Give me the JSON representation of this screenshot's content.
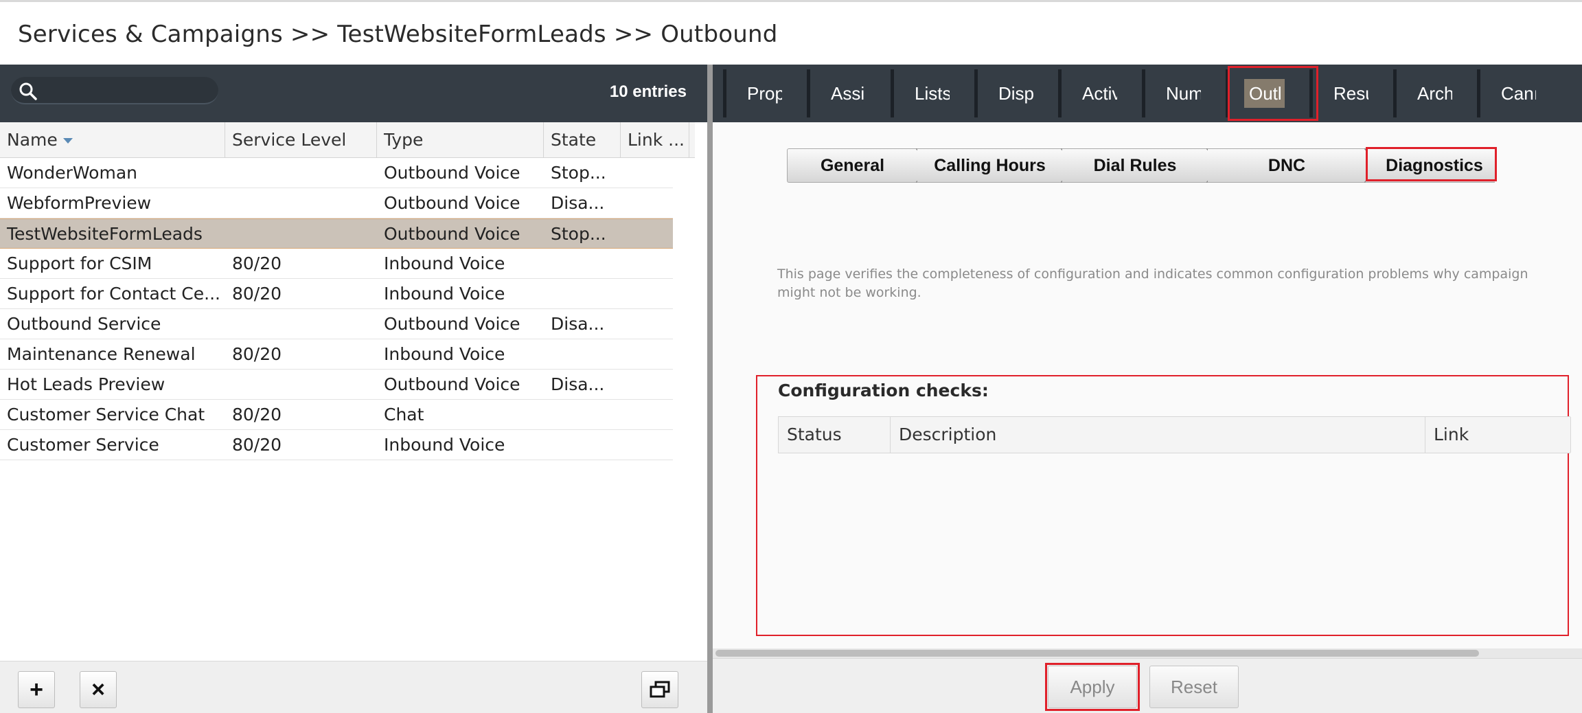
{
  "header": {
    "breadcrumb": "Services & Campaigns >> TestWebsiteFormLeads >> Outbound"
  },
  "left_panel": {
    "search": {
      "placeholder": "",
      "icon": "search-icon"
    },
    "entries_count": "10 entries",
    "columns": [
      "Name",
      "Service Level",
      "Type",
      "State",
      "Link ..."
    ],
    "sort_column": "Name",
    "rows": [
      {
        "name": "WonderWoman",
        "service_level": "",
        "type": "Outbound Voice",
        "state": "Stop...",
        "link": ""
      },
      {
        "name": "WebformPreview",
        "service_level": "",
        "type": "Outbound Voice",
        "state": "Disa...",
        "link": ""
      },
      {
        "name": "TestWebsiteFormLeads",
        "service_level": "",
        "type": "Outbound Voice",
        "state": "Stop...",
        "link": "",
        "selected": true
      },
      {
        "name": "Support for CSIM",
        "service_level": "80/20",
        "type": "Inbound Voice",
        "state": "",
        "link": ""
      },
      {
        "name": "Support for Contact Ce...",
        "service_level": "80/20",
        "type": "Inbound Voice",
        "state": "",
        "link": ""
      },
      {
        "name": "Outbound Service",
        "service_level": "",
        "type": "Outbound Voice",
        "state": "Disa...",
        "link": ""
      },
      {
        "name": "Maintenance Renewal",
        "service_level": "80/20",
        "type": "Inbound Voice",
        "state": "",
        "link": ""
      },
      {
        "name": "Hot Leads Preview",
        "service_level": "",
        "type": "Outbound Voice",
        "state": "Disa...",
        "link": ""
      },
      {
        "name": "Customer Service Chat",
        "service_level": "80/20",
        "type": "Chat",
        "state": "",
        "link": ""
      },
      {
        "name": "Customer Service",
        "service_level": "80/20",
        "type": "Inbound Voice",
        "state": "",
        "link": ""
      }
    ],
    "footer_buttons": {
      "add": "+",
      "delete": "×",
      "window_icon": "restore-window-icon"
    }
  },
  "right_panel": {
    "tabs": [
      "Prop",
      "Assi",
      "Lists",
      "Disp",
      "Activ",
      "Num",
      "Outl",
      "Resu",
      "Arch",
      "Canı"
    ],
    "active_tab": "Outl",
    "subtabs": [
      "General",
      "Calling Hours",
      "Dial Rules",
      "DNC",
      "Diagnostics"
    ],
    "active_subtab": "Diagnostics",
    "description": "This page verifies the completeness of configuration and indicates common configuration problems why campaign might not be working.",
    "checks_title": "Configuration checks:",
    "checks_columns": [
      "Status",
      "Description",
      "Link"
    ],
    "buttons": {
      "apply": "Apply",
      "reset": "Reset"
    }
  },
  "colors": {
    "toolbar_bg": "#353d45",
    "selected_row": "#cbc2b8",
    "active_tab": "#857b6c",
    "highlight_border": "#e0202a"
  }
}
